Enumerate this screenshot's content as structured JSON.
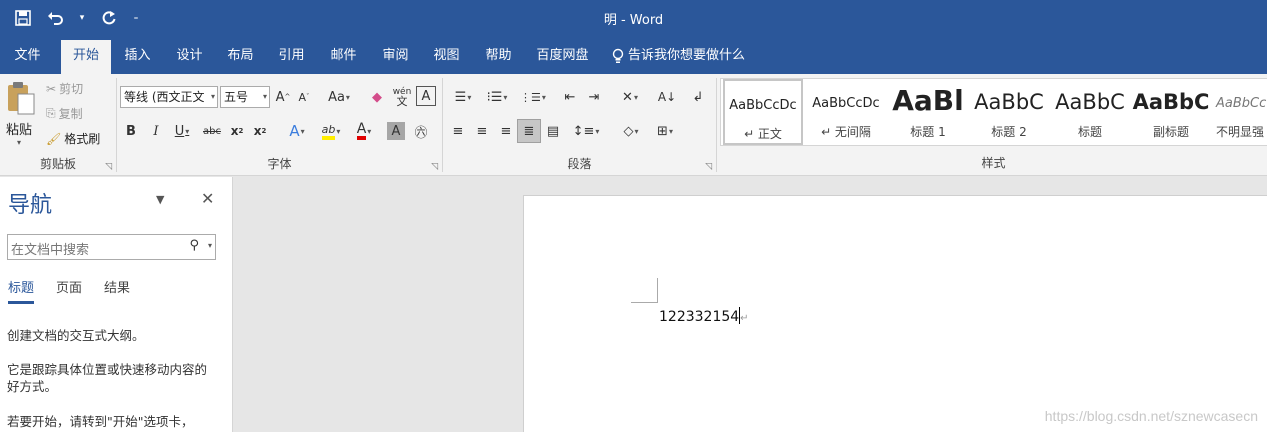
{
  "window": {
    "title": "明 - Word"
  },
  "qat": {
    "save_icon": "save-icon",
    "undo_icon": "undo-icon",
    "redo_icon": "redo-icon",
    "customize_icon": "chevron-down-icon"
  },
  "tabs": [
    {
      "label": "文件"
    },
    {
      "label": "开始"
    },
    {
      "label": "插入"
    },
    {
      "label": "设计"
    },
    {
      "label": "布局"
    },
    {
      "label": "引用"
    },
    {
      "label": "邮件"
    },
    {
      "label": "审阅"
    },
    {
      "label": "视图"
    },
    {
      "label": "帮助"
    },
    {
      "label": "百度网盘"
    }
  ],
  "tell_me": "告诉我你想要做什么",
  "clipboard": {
    "paste": "粘贴",
    "cut": "剪切",
    "copy": "复制",
    "format_painter": "格式刷",
    "label": "剪贴板"
  },
  "font": {
    "name": "等线 (西文正文",
    "size": "五号",
    "label": "字体"
  },
  "paragraph": {
    "label": "段落"
  },
  "styles": {
    "label": "样式",
    "items": [
      {
        "preview": "AaBbCcDc",
        "name": "↵ 正文"
      },
      {
        "preview": "AaBbCcDc",
        "name": "↵ 无间隔"
      },
      {
        "preview": "AaBl",
        "name": "标题 1"
      },
      {
        "preview": "AaBbC",
        "name": "标题 2"
      },
      {
        "preview": "AaBbC",
        "name": "标题"
      },
      {
        "preview": "AaBbC",
        "name": "副标题"
      },
      {
        "preview": "AaBbCc",
        "name": "不明显强"
      }
    ]
  },
  "nav": {
    "title": "导航",
    "search_placeholder": "在文档中搜索",
    "tabs": [
      {
        "label": "标题"
      },
      {
        "label": "页面"
      },
      {
        "label": "结果"
      }
    ],
    "p1": "创建文档的交互式大纲。",
    "p2": "它是跟踪具体位置或快速移动内容的好方式。",
    "p3": "若要开始，请转到\"开始\"选项卡，"
  },
  "document": {
    "text": "122332154"
  },
  "watermark": "https://blog.csdn.net/sznewcasecn"
}
